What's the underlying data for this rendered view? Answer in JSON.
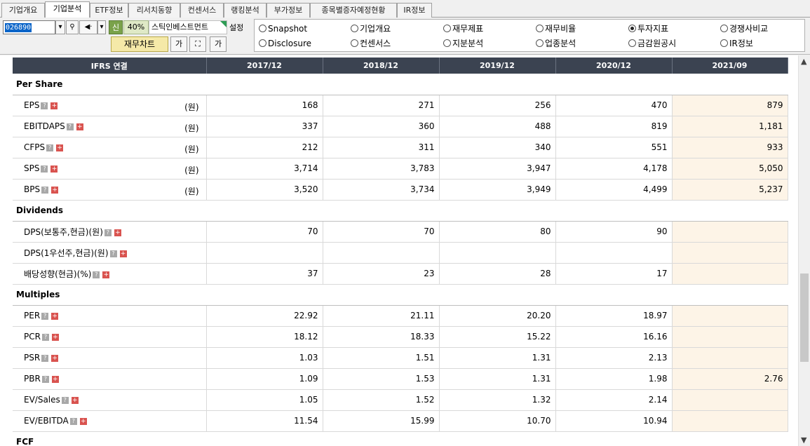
{
  "tabs": [
    "기업개요",
    "기업분석",
    "ETF정보",
    "리서치동향",
    "컨센서스",
    "랭킹분석",
    "부가정보",
    "종목별증자예정현황",
    "IR정보"
  ],
  "toolbar": {
    "code": "026890",
    "sin": "신",
    "pct": "40%",
    "company": "스틱인베스트먼트",
    "setting": "설정",
    "chart_btn": "재무차트",
    "font_small": "가",
    "font_large": "가"
  },
  "radios": [
    {
      "label": "Snapshot",
      "selected": false
    },
    {
      "label": "기업개요",
      "selected": false
    },
    {
      "label": "재무제표",
      "selected": false
    },
    {
      "label": "재무비율",
      "selected": false
    },
    {
      "label": "투자지표",
      "selected": true
    },
    {
      "label": "경쟁사비교",
      "selected": false
    },
    {
      "label": "Disclosure",
      "selected": false
    },
    {
      "label": "컨센서스",
      "selected": false
    },
    {
      "label": "지분분석",
      "selected": false
    },
    {
      "label": "업종분석",
      "selected": false
    },
    {
      "label": "금감원공시",
      "selected": false
    },
    {
      "label": "IR정보",
      "selected": false
    }
  ],
  "table": {
    "header": [
      "IFRS 연결",
      "2017/12",
      "2018/12",
      "2019/12",
      "2020/12",
      "2021/09"
    ],
    "unit": "(원)",
    "sections": [
      {
        "title": "Per Share",
        "rows": [
          {
            "label": "EPS",
            "unit": true,
            "values": [
              "168",
              "271",
              "256",
              "470",
              "879"
            ]
          },
          {
            "label": "EBITDAPS",
            "unit": true,
            "values": [
              "337",
              "360",
              "488",
              "819",
              "1,181"
            ]
          },
          {
            "label": "CFPS",
            "unit": true,
            "values": [
              "212",
              "311",
              "340",
              "551",
              "933"
            ]
          },
          {
            "label": "SPS",
            "unit": true,
            "values": [
              "3,714",
              "3,783",
              "3,947",
              "4,178",
              "5,050"
            ]
          },
          {
            "label": "BPS",
            "unit": true,
            "values": [
              "3,520",
              "3,734",
              "3,949",
              "4,499",
              "5,237"
            ]
          }
        ]
      },
      {
        "title": "Dividends",
        "rows": [
          {
            "label": "DPS(보통주,현금)(원)",
            "unit": false,
            "values": [
              "70",
              "70",
              "80",
              "90",
              ""
            ]
          },
          {
            "label": "DPS(1우선주,현금)(원)",
            "unit": false,
            "values": [
              "",
              "",
              "",
              "",
              ""
            ]
          },
          {
            "label": "배당성향(현금)(%)",
            "unit": false,
            "values": [
              "37",
              "23",
              "28",
              "17",
              ""
            ]
          }
        ]
      },
      {
        "title": "Multiples",
        "rows": [
          {
            "label": "PER",
            "unit": false,
            "values": [
              "22.92",
              "21.11",
              "20.20",
              "18.97",
              ""
            ]
          },
          {
            "label": "PCR",
            "unit": false,
            "values": [
              "18.12",
              "18.33",
              "15.22",
              "16.16",
              ""
            ]
          },
          {
            "label": "PSR",
            "unit": false,
            "values": [
              "1.03",
              "1.51",
              "1.31",
              "2.13",
              ""
            ]
          },
          {
            "label": "PBR",
            "unit": false,
            "values": [
              "1.09",
              "1.53",
              "1.31",
              "1.98",
              "2.76"
            ]
          },
          {
            "label": "EV/Sales",
            "unit": false,
            "values": [
              "1.05",
              "1.52",
              "1.32",
              "2.14",
              ""
            ]
          },
          {
            "label": "EV/EBITDA",
            "unit": false,
            "values": [
              "11.54",
              "15.99",
              "10.70",
              "10.94",
              ""
            ]
          }
        ]
      },
      {
        "title": "FCF",
        "rows": []
      }
    ]
  }
}
